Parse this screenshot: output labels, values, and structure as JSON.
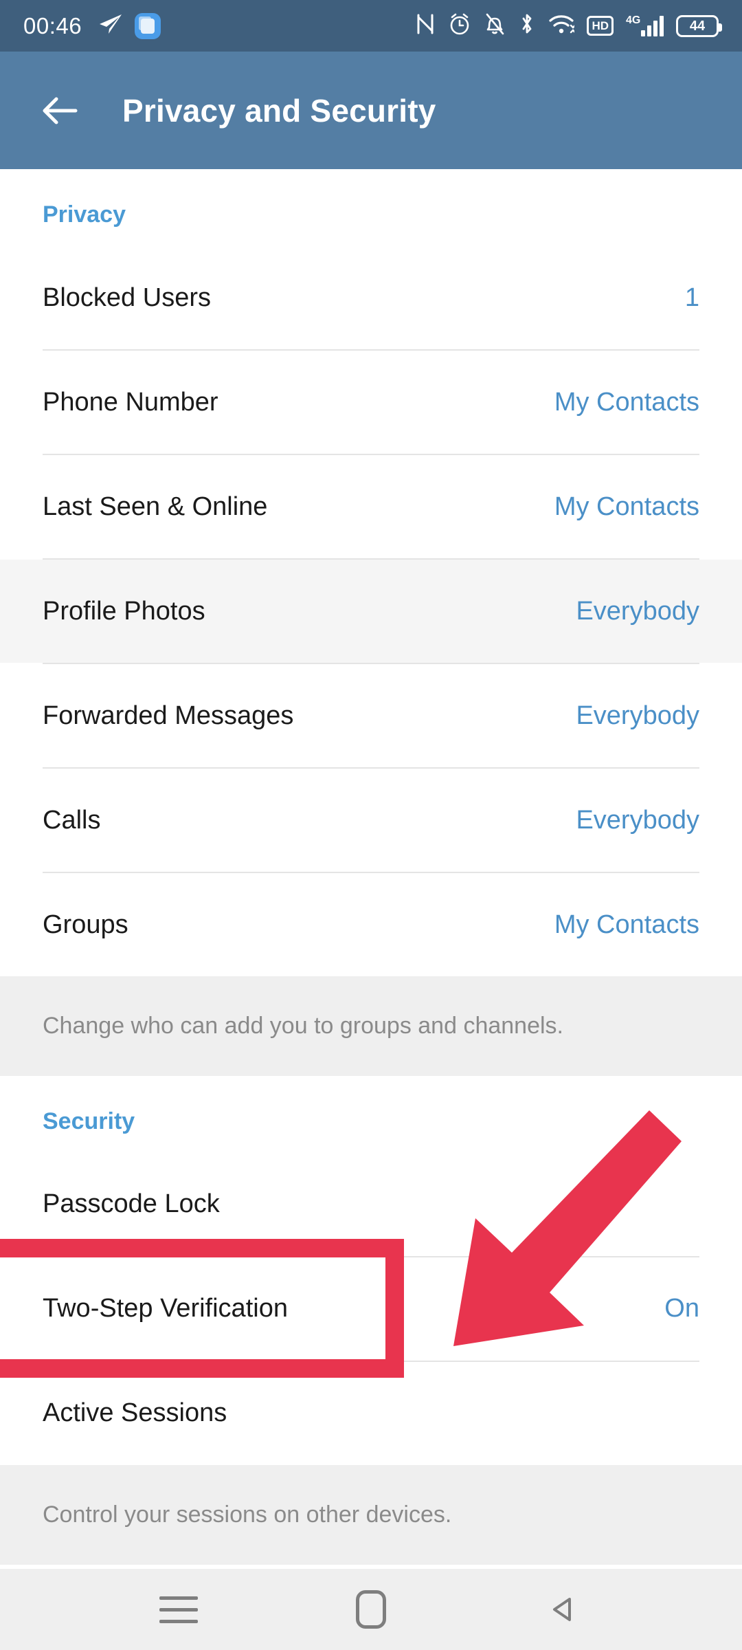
{
  "status_bar": {
    "clock": "00:46",
    "left_icons": [
      "telegram-send-icon",
      "app-badge-icon"
    ],
    "right_icons": [
      "nfc-icon",
      "alarm-clock-icon",
      "notifications-muted-icon",
      "bluetooth-icon",
      "wifi-icon",
      "hd-icon",
      "4g-signal-icon",
      "battery-icon"
    ],
    "hd_label": "HD",
    "network_label": "4G",
    "battery_level": "44"
  },
  "app_bar": {
    "back_icon": "back-arrow-icon",
    "title": "Privacy and Security"
  },
  "privacy_section": {
    "header": "Privacy",
    "rows": [
      {
        "label": "Blocked Users",
        "value": "1",
        "tinted": false
      },
      {
        "label": "Phone Number",
        "value": "My Contacts",
        "tinted": false
      },
      {
        "label": "Last Seen & Online",
        "value": "My Contacts",
        "tinted": false
      },
      {
        "label": "Profile Photos",
        "value": "Everybody",
        "tinted": true
      },
      {
        "label": "Forwarded Messages",
        "value": "Everybody",
        "tinted": false
      },
      {
        "label": "Calls",
        "value": "Everybody",
        "tinted": false
      },
      {
        "label": "Groups",
        "value": "My Contacts",
        "tinted": false
      }
    ],
    "hint": "Change who can add you to groups and channels."
  },
  "security_section": {
    "header": "Security",
    "rows": [
      {
        "label": "Passcode Lock",
        "value": ""
      },
      {
        "label": "Two-Step Verification",
        "value": "On"
      },
      {
        "label": "Active Sessions",
        "value": ""
      }
    ],
    "hint": "Control your sessions on other devices."
  },
  "annotations": {
    "highlight_target": "Two-Step Verification",
    "highlight_color": "#e8344e",
    "arrow_color": "#e8344e"
  },
  "nav_bar": {
    "buttons": [
      "recents-menu-icon",
      "home-icon",
      "back-triangle-icon"
    ]
  },
  "colors": {
    "status_bar_bg": "#3f5f7d",
    "app_bar_bg": "#547ea4",
    "accent_blue": "#4a9ad4",
    "value_blue": "#4a8fc7",
    "hint_bg": "#efefef",
    "hint_text": "#8a8a8a",
    "row_tint": "#f5f5f5"
  }
}
